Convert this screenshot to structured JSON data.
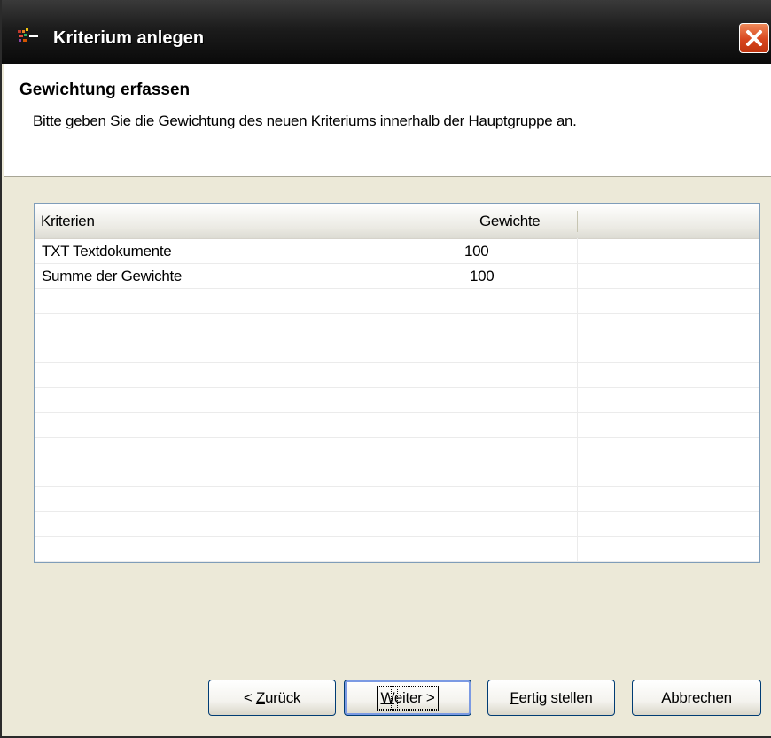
{
  "window": {
    "title": "Kriterium anlegen",
    "close_icon": "close-icon"
  },
  "header": {
    "title": "Gewichtung erfassen",
    "description": "Bitte geben Sie die Gewichtung des neuen Kriteriums innerhalb der Hauptgruppe an."
  },
  "list": {
    "columns": [
      "Kriterien",
      "Gewichte"
    ],
    "rows": [
      {
        "name": "TXT Textdokumente",
        "weight": "100"
      },
      {
        "name": "Summe der Gewichte",
        "weight": "100"
      }
    ]
  },
  "buttons": {
    "back": {
      "prefix": "< ",
      "mnemonic": "Z",
      "rest": "urück"
    },
    "next": {
      "mnemonic": "W",
      "rest": "eiter >"
    },
    "finish": {
      "mnemonic": "F",
      "rest": "ertig stellen"
    },
    "cancel": {
      "label": "Abbrechen"
    }
  },
  "colors": {
    "title_bar": "#1c1c1c",
    "close_button": "#d8461e",
    "dialog_background": "#ece9d8",
    "list_border": "#7f9db9"
  }
}
